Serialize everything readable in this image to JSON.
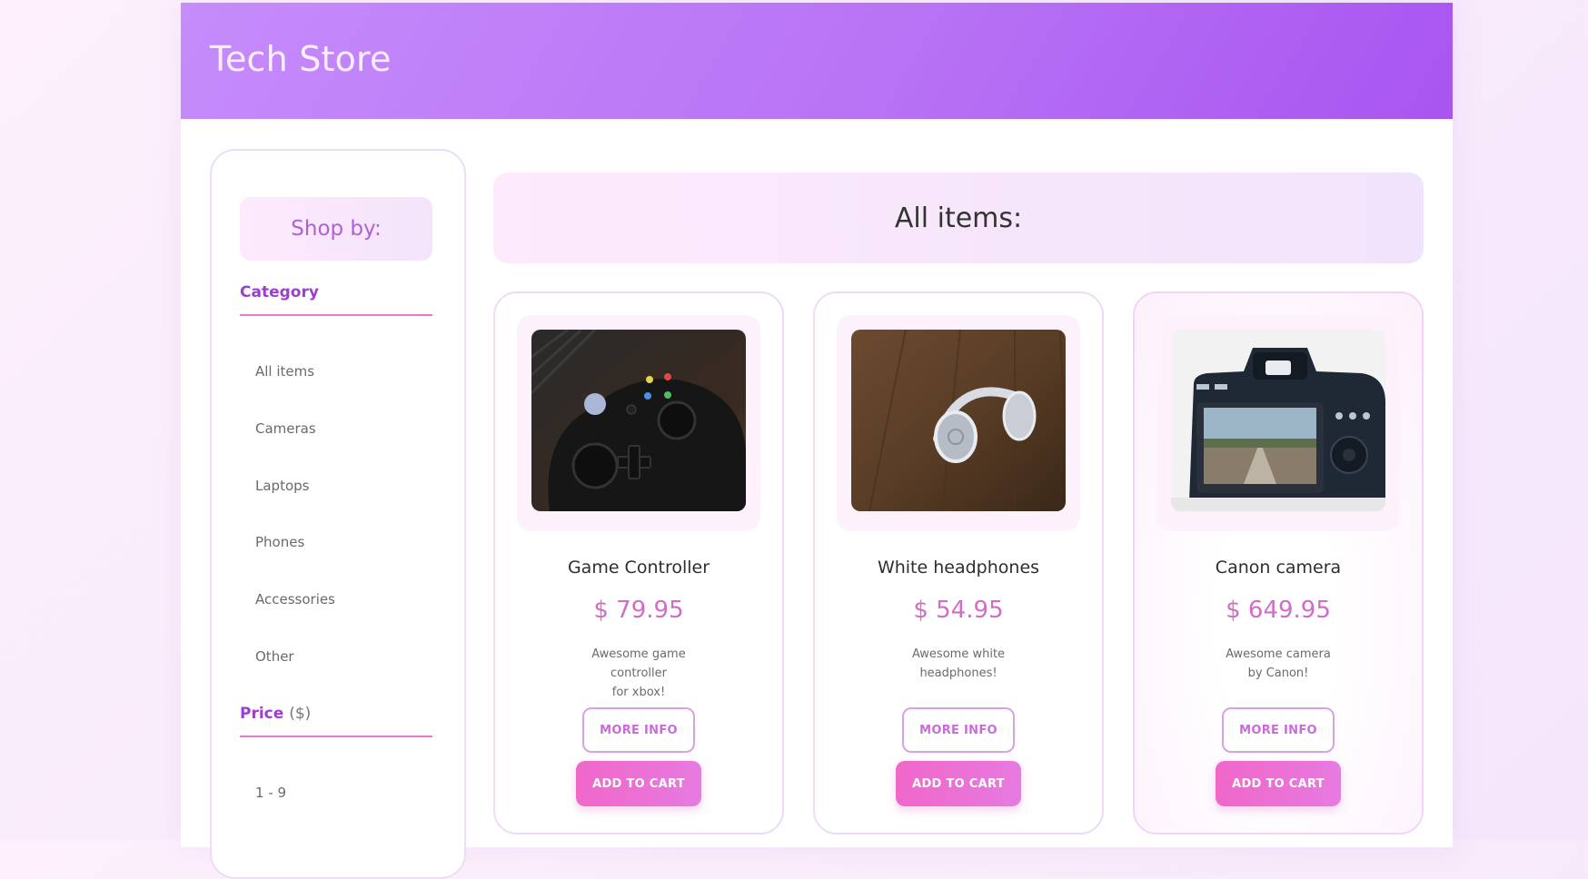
{
  "header": {
    "title": "Tech Store"
  },
  "sidebar": {
    "heading": "Shop by:",
    "category": {
      "title": "Category",
      "items": [
        "All items",
        "Cameras",
        "Laptops",
        "Phones",
        "Accessories",
        "Other"
      ]
    },
    "price": {
      "title": "Price",
      "unit": "($)",
      "items": [
        "1 - 9"
      ]
    }
  },
  "main": {
    "heading": "All items:",
    "products": [
      {
        "title": "Game Controller",
        "price": "$ 79.95",
        "desc_line1": "Awesome game controller",
        "desc_line2": "for xbox!",
        "more_label": "MORE INFO",
        "cart_label": "ADD TO CART",
        "image": "game-controller-photo"
      },
      {
        "title": "White headphones",
        "price": "$ 54.95",
        "desc_line1": "Awesome white",
        "desc_line2": "headphones!",
        "more_label": "MORE INFO",
        "cart_label": "ADD TO CART",
        "image": "headphones-photo"
      },
      {
        "title": "Canon camera",
        "price": "$ 649.95",
        "desc_line1": "Awesome camera",
        "desc_line2": "by Canon!",
        "more_label": "MORE INFO",
        "cart_label": "ADD TO CART",
        "image": "canon-camera-photo"
      }
    ]
  },
  "colors": {
    "header_start": "#c68cfb",
    "header_end": "#a855f0",
    "accent_purple": "#9a3fd0",
    "price_pink": "#d46bc6",
    "cart_button": "#f067c9"
  }
}
